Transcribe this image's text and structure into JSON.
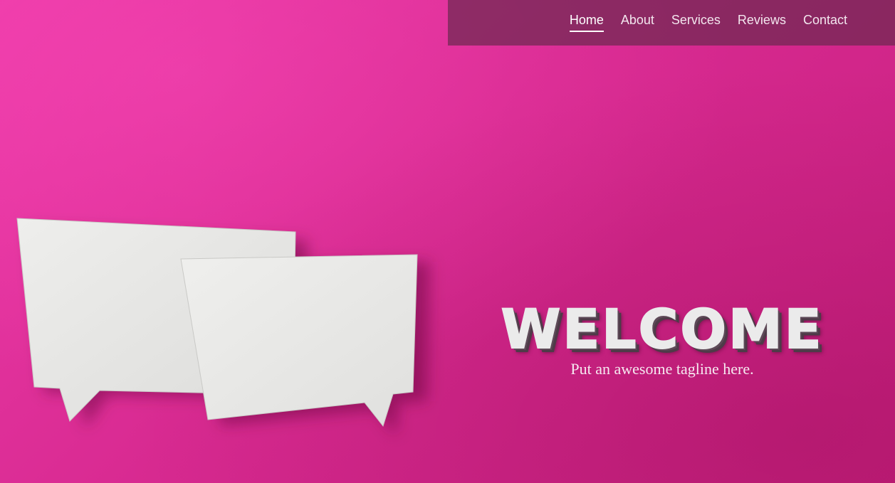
{
  "nav": {
    "items": [
      {
        "label": "Home",
        "active": true
      },
      {
        "label": "About",
        "active": false
      },
      {
        "label": "Services",
        "active": false
      },
      {
        "label": "Reviews",
        "active": false
      },
      {
        "label": "Contact",
        "active": false
      }
    ]
  },
  "hero": {
    "title": "WELCOME",
    "tagline": "Put an awesome tagline here.",
    "background_color": "#d82a91",
    "image": "paper-speech-bubbles-illustration"
  }
}
